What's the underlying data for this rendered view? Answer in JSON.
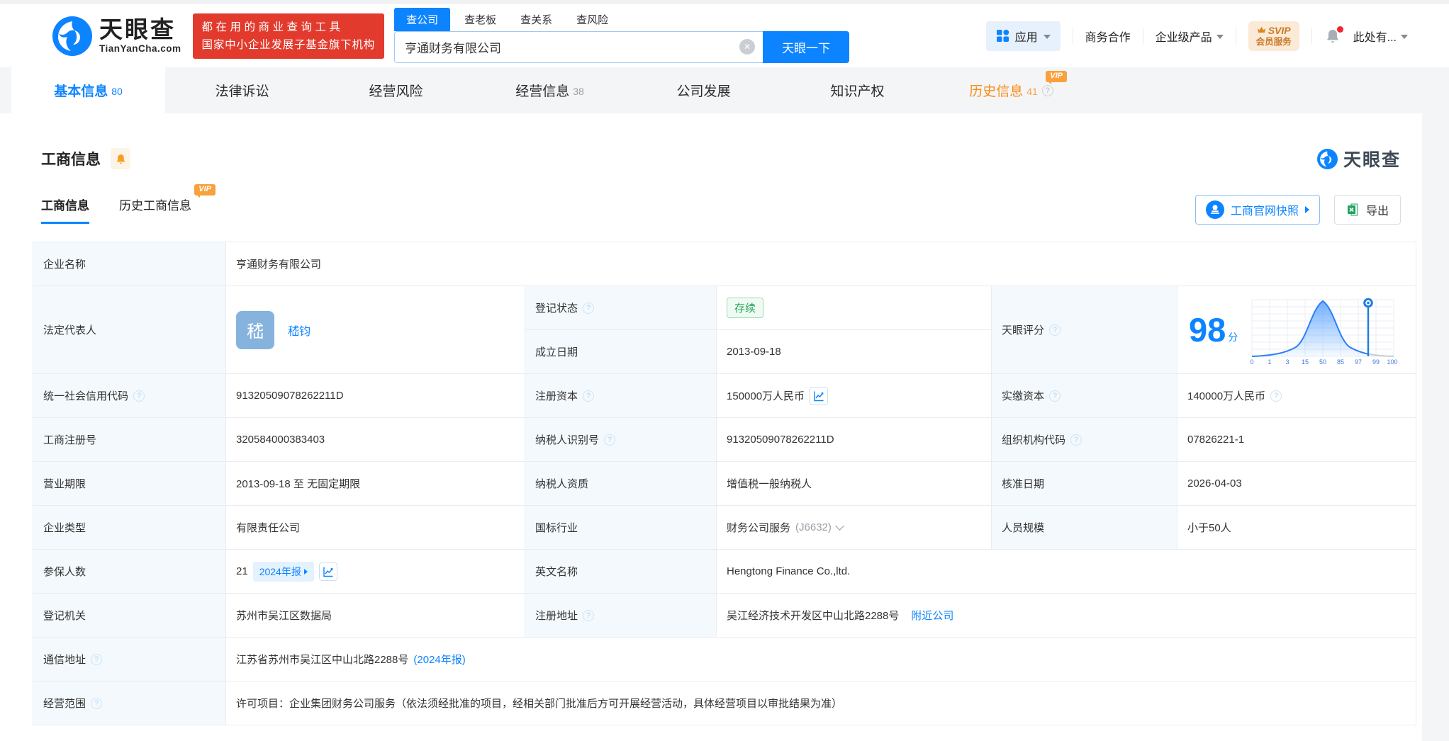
{
  "colors": {
    "accent": "#0d84ff",
    "promo_red": "#e23b2e",
    "vip_orange": "#f9a13c",
    "history_orange": "#fa8c16",
    "status_green": "#28a45c"
  },
  "header": {
    "logo_cn": "天眼查",
    "logo_en": "TianYanCha.com",
    "promo_line1": "都在用的商业查询工具",
    "promo_line2": "国家中小企业发展子基金旗下机构",
    "search_tabs": [
      {
        "label": "查公司"
      },
      {
        "label": "查老板"
      },
      {
        "label": "查关系"
      },
      {
        "label": "查风险"
      }
    ],
    "search_value": "亨通财务有限公司",
    "search_button": "天眼一下",
    "nav_apps": "应用",
    "nav_biz": "商务合作",
    "nav_enterprise": "企业级产品",
    "svip_line1": "SVIP",
    "svip_line2": "会员服务",
    "nav_more": "此处有..."
  },
  "vip_badge": "VIP",
  "tabs": [
    {
      "label": "基本信息",
      "count": "80"
    },
    {
      "label": "法律诉讼",
      "count": ""
    },
    {
      "label": "经营风险",
      "count": ""
    },
    {
      "label": "经营信息",
      "count": "38"
    },
    {
      "label": "公司发展",
      "count": ""
    },
    {
      "label": "知识产权",
      "count": ""
    },
    {
      "label": "历史信息",
      "count": "41"
    }
  ],
  "section": {
    "title": "工商信息",
    "brand": "天眼查",
    "subtab_active": "工商信息",
    "subtab_history": "历史工商信息",
    "snapshot_button": "工商官网快照",
    "export_button": "导出"
  },
  "fields": {
    "company_name": {
      "label": "企业名称",
      "value": "亨通财务有限公司"
    },
    "legal_rep": {
      "label": "法定代表人",
      "avatar": "嵇",
      "name": "嵇钧"
    },
    "reg_status": {
      "label": "登记状态",
      "value": "存续"
    },
    "establish_date": {
      "label": "成立日期",
      "value": "2013-09-18"
    },
    "credit_code": {
      "label": "统一社会信用代码",
      "value": "91320509078262211D"
    },
    "reg_capital": {
      "label": "注册资本",
      "value": "150000万人民币"
    },
    "paid_capital": {
      "label": "实缴资本",
      "value": "140000万人民币"
    },
    "reg_number": {
      "label": "工商注册号",
      "value": "320584000383403"
    },
    "taxpayer_id": {
      "label": "纳税人识别号",
      "value": "91320509078262211D"
    },
    "org_code": {
      "label": "组织机构代码",
      "value": "07826221-1"
    },
    "business_term": {
      "label": "营业期限",
      "value": "2013-09-18 至 无固定期限"
    },
    "taxpayer_quality": {
      "label": "纳税人资质",
      "value": "增值税一般纳税人"
    },
    "approval_date": {
      "label": "核准日期",
      "value": "2026-04-03"
    },
    "company_type": {
      "label": "企业类型",
      "value": "有限责任公司"
    },
    "industry": {
      "label": "国标行业",
      "value": "财务公司服务",
      "code": "(J6632)"
    },
    "staff_size": {
      "label": "人员规模",
      "value": "小于50人"
    },
    "insured_count": {
      "label": "参保人数",
      "value": "21",
      "badge": "2024年报"
    },
    "english_name": {
      "label": "英文名称",
      "value": "Hengtong Finance Co.,ltd."
    },
    "reg_authority": {
      "label": "登记机关",
      "value": "苏州市吴江区数据局"
    },
    "reg_address": {
      "label": "注册地址",
      "value": "吴江经济技术开发区中山北路2288号",
      "link": "附近公司"
    },
    "mail_address": {
      "label": "通信地址",
      "value": "江苏省苏州市吴江区中山北路2288号",
      "link": "(2024年报)"
    },
    "business_scope": {
      "label": "经营范围",
      "value": "许可项目：企业集团财务公司服务（依法须经批准的项目，经相关部门批准后方可开展经营活动，具体经营项目以审批结果为准）"
    }
  },
  "score": {
    "label": "天眼评分",
    "value": "98",
    "unit": "分",
    "axis": [
      "0",
      "1",
      "3",
      "15",
      "50",
      "85",
      "97",
      "99",
      "100"
    ]
  }
}
